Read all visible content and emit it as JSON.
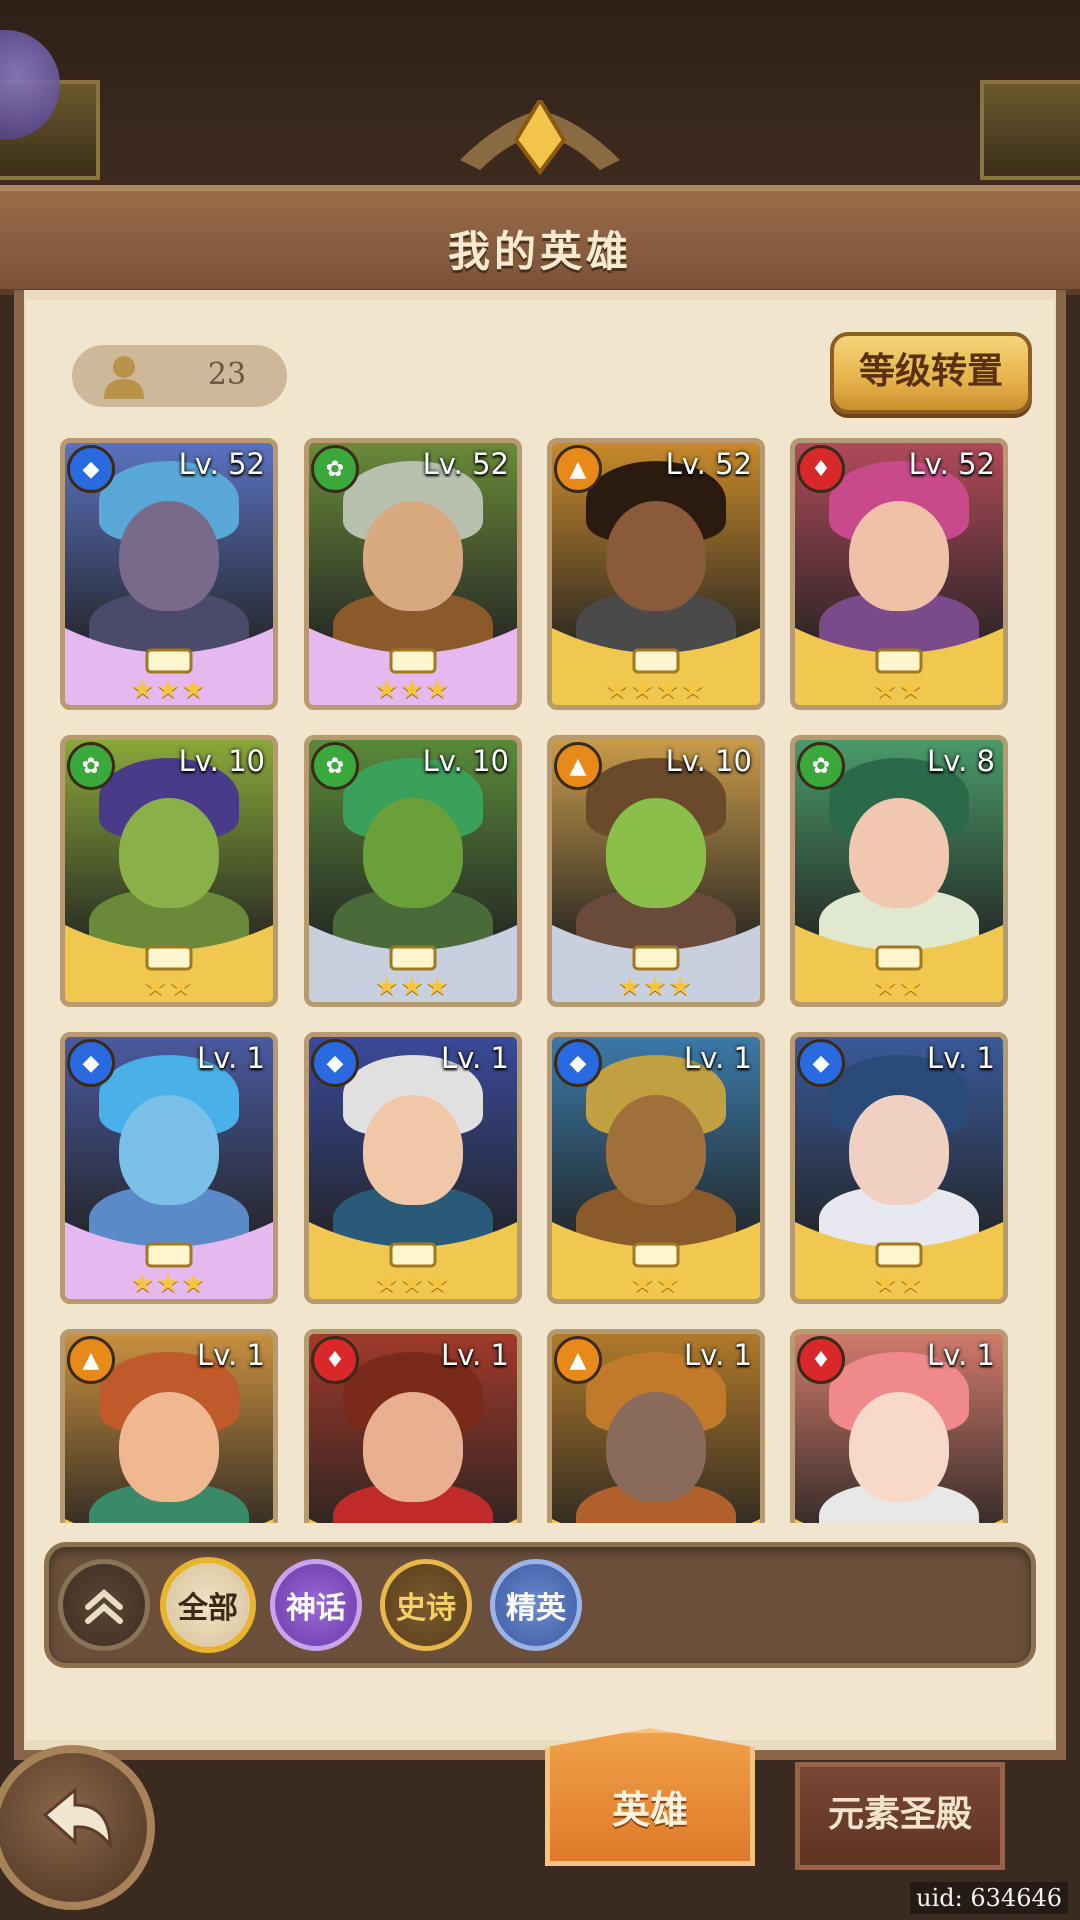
{
  "header": {
    "title": "我的英雄"
  },
  "hero_count": {
    "icon": "person-icon",
    "value": "23"
  },
  "reset_button": {
    "label": "等级转置"
  },
  "heroes": [
    {
      "level": "Lv. 52",
      "element": "water",
      "stars": "★★★",
      "rarity": "mythic",
      "portrait_bg": "#5a72c0",
      "skin": "#7a6a8a",
      "hair": "#5aa8d8",
      "body": "#4a4a6a"
    },
    {
      "level": "Lv. 52",
      "element": "nature",
      "stars": "★★★",
      "rarity": "mythic",
      "portrait_bg": "#6a8a3a",
      "skin": "#d8a880",
      "hair": "#b8c0b0",
      "body": "#8a5a2a"
    },
    {
      "level": "Lv. 52",
      "element": "fire",
      "stars": "★★★★",
      "rarity": "epic",
      "portrait_bg": "#c88a2a",
      "skin": "#8a5a3a",
      "hair": "#2a1a10",
      "body": "#4a4a4a"
    },
    {
      "level": "Lv. 52",
      "element": "flame",
      "stars": "★★",
      "rarity": "epic",
      "portrait_bg": "#b04a5a",
      "skin": "#f0c0a8",
      "hair": "#c84a8a",
      "body": "#7a4a8a"
    },
    {
      "level": "Lv. 10",
      "element": "nature",
      "stars": "★★",
      "rarity": "epic",
      "portrait_bg": "#8aa83a",
      "skin": "#8ab04a",
      "hair": "#4a3a8a",
      "body": "#6a8a3a"
    },
    {
      "level": "Lv. 10",
      "element": "nature",
      "stars": "★★★",
      "rarity": "elite",
      "portrait_bg": "#5a8a3a",
      "skin": "#6aa03a",
      "hair": "#3aa05a",
      "body": "#4a6a3a"
    },
    {
      "level": "Lv. 10",
      "element": "fire",
      "stars": "★★★",
      "rarity": "elite",
      "portrait_bg": "#c89a4a",
      "skin": "#8ac04a",
      "hair": "#6a4a2a",
      "body": "#6a4a3a"
    },
    {
      "level": "Lv. 8",
      "element": "nature",
      "stars": "★★",
      "rarity": "epic",
      "portrait_bg": "#4a9a6a",
      "skin": "#f0c8b0",
      "hair": "#2a6a4a",
      "body": "#e0e8d0"
    },
    {
      "level": "Lv. 1",
      "element": "water",
      "stars": "★★★",
      "rarity": "mythic",
      "portrait_bg": "#4a5aa0",
      "skin": "#7ac0e8",
      "hair": "#4ab0e8",
      "body": "#5a8ac8"
    },
    {
      "level": "Lv. 1",
      "element": "water",
      "stars": "★★★",
      "rarity": "epic",
      "portrait_bg": "#3a4a9a",
      "skin": "#f0c8a8",
      "hair": "#e0e0e0",
      "body": "#2a5a7a"
    },
    {
      "level": "Lv. 1",
      "element": "water",
      "stars": "★★",
      "rarity": "epic",
      "portrait_bg": "#3a7aa8",
      "skin": "#a0703a",
      "hair": "#c0a040",
      "body": "#8a5a2a"
    },
    {
      "level": "Lv. 1",
      "element": "water",
      "stars": "★★",
      "rarity": "epic",
      "portrait_bg": "#3a5a9a",
      "skin": "#f0d0c0",
      "hair": "#2a4a7a",
      "body": "#e8e8f0"
    },
    {
      "level": "Lv. 1",
      "element": "fire",
      "stars": "",
      "rarity": "epic",
      "portrait_bg": "#c89040",
      "skin": "#f0b890",
      "hair": "#c05a2a",
      "body": "#3a8a6a"
    },
    {
      "level": "Lv. 1",
      "element": "flame",
      "stars": "",
      "rarity": "epic",
      "portrait_bg": "#a03a2a",
      "skin": "#e8b090",
      "hair": "#7a2a1a",
      "body": "#c02a2a"
    },
    {
      "level": "Lv. 1",
      "element": "fire",
      "stars": "",
      "rarity": "epic",
      "portrait_bg": "#b07a2a",
      "skin": "#8a6a5a",
      "hair": "#c07a2a",
      "body": "#b0602a"
    },
    {
      "level": "Lv. 1",
      "element": "flame",
      "stars": "",
      "rarity": "epic",
      "portrait_bg": "#d07a6a",
      "skin": "#f8d8c8",
      "hair": "#f08a8a",
      "body": "#e8e8e8"
    }
  ],
  "element_colors": {
    "water": "#2a6ae0",
    "nature": "#3aa83a",
    "fire": "#e88a1a",
    "flame": "#d8282a"
  },
  "filters": {
    "collapse_icon": "double-chevron-up-icon",
    "all": "全部",
    "mythic": "神话",
    "epic": "史诗",
    "elite": "精英"
  },
  "bottom_tabs": {
    "heroes": "英雄",
    "elemental_temple": "元素圣殿"
  },
  "back_icon": "back-arrow-icon",
  "uid": "uid: 634646"
}
